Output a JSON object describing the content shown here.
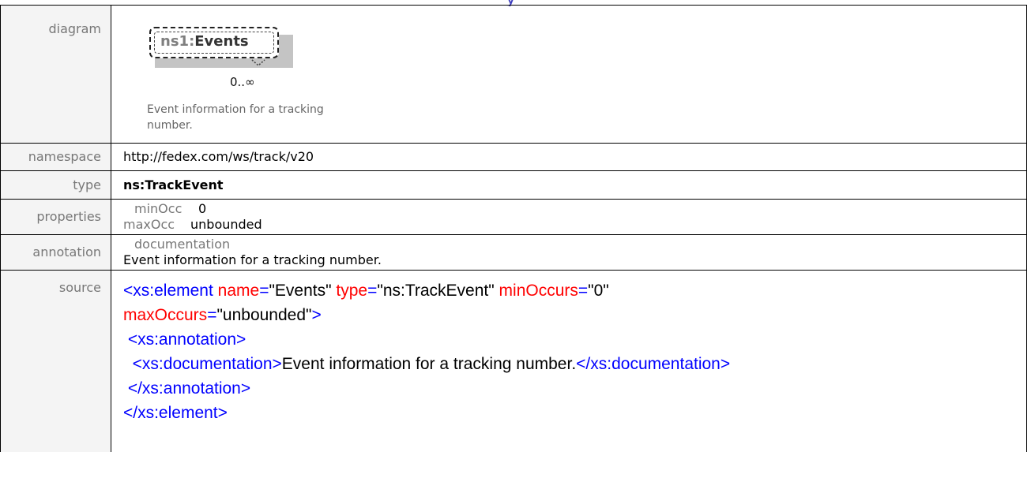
{
  "diagram": {
    "label": "diagram",
    "element_prefix": "ns1",
    "element_sep": ":",
    "element_local": "Events",
    "occurrence": "0..∞",
    "description": "Event information for a tracking number."
  },
  "namespace": {
    "label": "namespace",
    "value": "http://fedex.com/ws/track/v20"
  },
  "type": {
    "label": "type",
    "value": "ns:TrackEvent"
  },
  "properties": {
    "label": "properties",
    "min_key": "minOcc",
    "min_val": "0",
    "max_key": "maxOcc",
    "max_val": "unbounded"
  },
  "annotation": {
    "label": "annotation",
    "doc_key": "documentation",
    "doc_val": "Event information for a tracking number."
  },
  "source": {
    "label": "source",
    "l1_tag": "<xs:element",
    "l1_a1": " name",
    "l1_eq1": "=",
    "l1_v1": "\"Events\"",
    "l1_a2": " type",
    "l1_eq2": "=",
    "l1_v2": "\"ns:TrackEvent\"",
    "l1_a3": " minOccurs",
    "l1_eq3": "=",
    "l1_v3": "\"0\"",
    "l2_a1": "maxOccurs",
    "l2_eq1": "=",
    "l2_v1": "\"unbounded\"",
    "l2_end": ">",
    "l3": " <xs:annotation>",
    "l4_open": "  <xs:documentation>",
    "l4_text": "Event information for a tracking number.",
    "l4_close": "</xs:documentation>",
    "l5": " </xs:annotation>",
    "l6": "</xs:element>"
  },
  "colors": {
    "tag": "#0000ff",
    "attr": "#ff0000",
    "label_bg": "#f4f4f4",
    "label_text": "#777777"
  }
}
